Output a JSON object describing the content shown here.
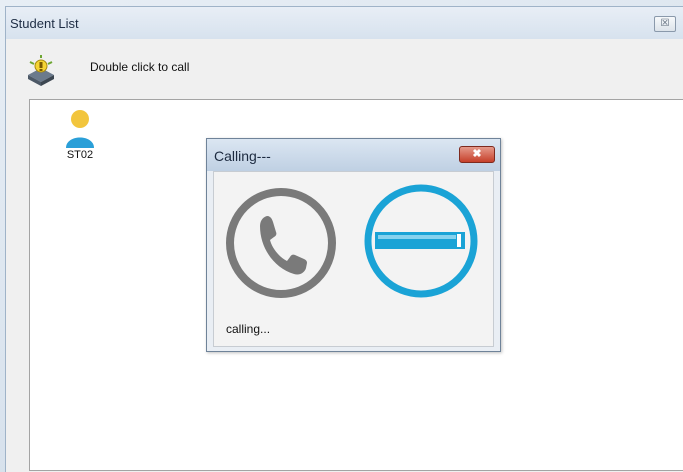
{
  "main_window": {
    "title": "Student List",
    "close_label": "☒",
    "hint": "Double click to call"
  },
  "students": [
    {
      "label": "ST02"
    }
  ],
  "dialog": {
    "title": "Calling---",
    "close_label": "✖",
    "status": "calling..."
  },
  "colors": {
    "hangup_accent": "#1aa3d6",
    "phone_gray": "#7a7a7a",
    "close_red": "#c6402a"
  },
  "icons": {
    "toolbar": "call-contact-icon",
    "student": "user-avatar-icon",
    "phone": "phone-icon",
    "hangup": "hang-up-icon"
  }
}
